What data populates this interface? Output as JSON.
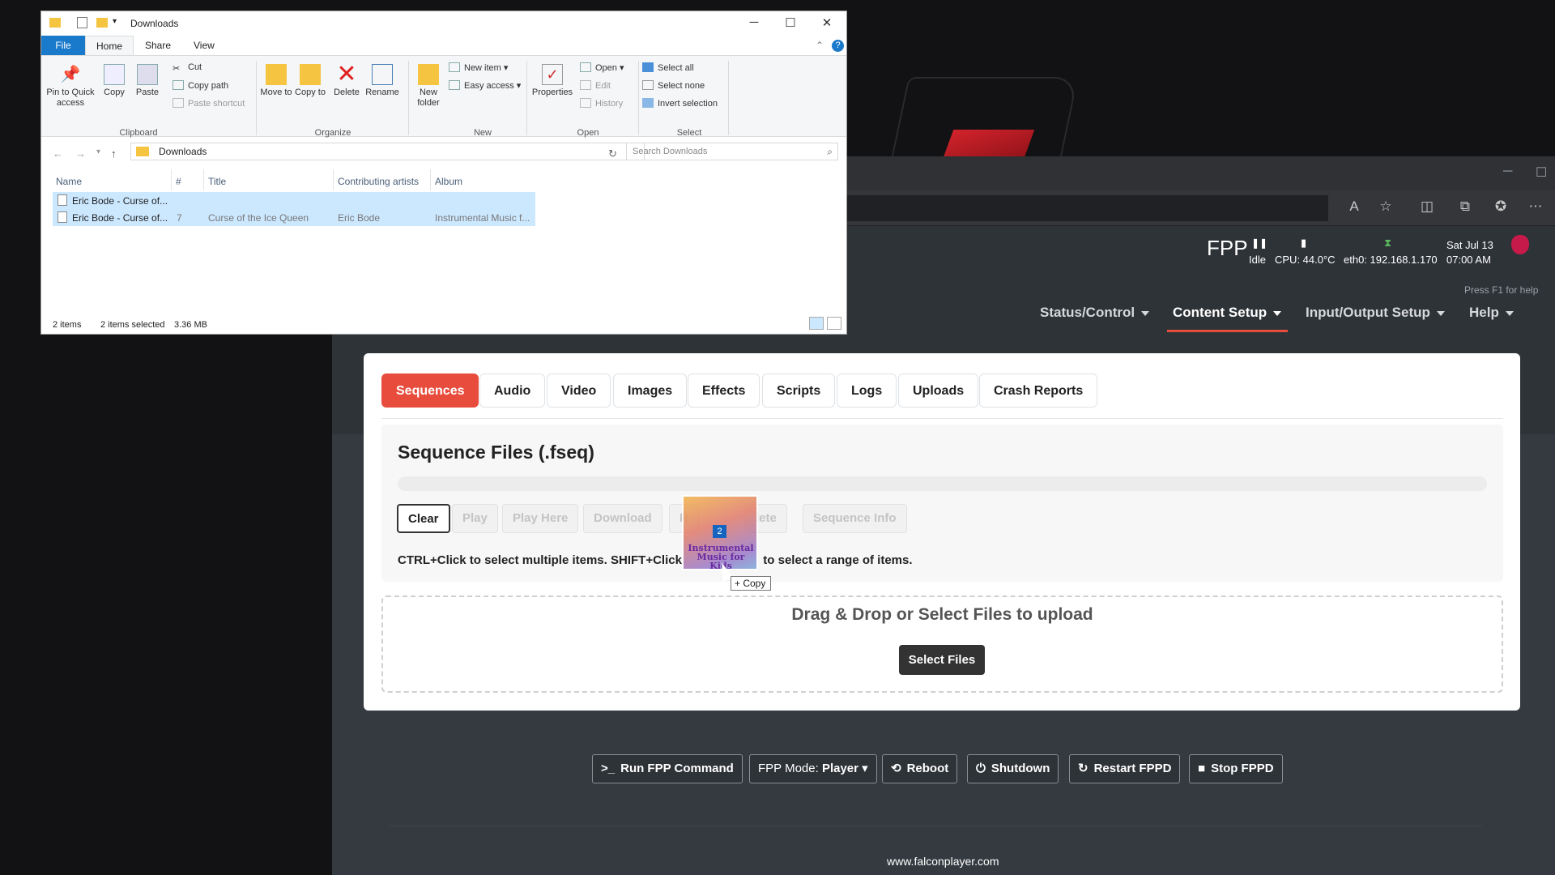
{
  "explorer": {
    "title": "Downloads",
    "window_controls": [
      "─",
      "☐",
      "✕"
    ],
    "tabs": {
      "file": "File",
      "home": "Home",
      "share": "Share",
      "view": "View"
    },
    "ribbon": {
      "pin": "Pin to Quick access",
      "copy": "Copy",
      "paste": "Paste",
      "cut": "Cut",
      "copy_path": "Copy path",
      "paste_shortcut": "Paste shortcut",
      "move_to": "Move to",
      "copy_to": "Copy to",
      "delete": "Delete",
      "rename": "Rename",
      "new_folder": "New folder",
      "new_item": "New item",
      "easy_access": "Easy access",
      "properties": "Properties",
      "open": "Open",
      "edit": "Edit",
      "history": "History",
      "select_all": "Select all",
      "select_none": "Select none",
      "invert_selection": "Invert selection",
      "groups": {
        "clipboard": "Clipboard",
        "organize": "Organize",
        "new": "New",
        "open": "Open",
        "select": "Select"
      }
    },
    "breadcrumb": "Downloads",
    "search_placeholder": "Search Downloads",
    "columns": {
      "name": "Name",
      "number": "#",
      "title": "Title",
      "artists": "Contributing artists",
      "album": "Album"
    },
    "rows": [
      {
        "name": "Eric Bode - Curse of...",
        "number": "",
        "title": "",
        "artists": "",
        "album": ""
      },
      {
        "name": "Eric Bode - Curse of...",
        "number": "7",
        "title": "Curse of the Ice Queen",
        "artists": "Eric Bode",
        "album": "Instrumental Music f..."
      }
    ],
    "status": {
      "count": "2 items",
      "selected": "2 items selected",
      "size": "3.36 MB"
    }
  },
  "fpp": {
    "logo": "FPP",
    "state": "Idle",
    "cpu": "CPU: 44.0°C",
    "network": "eth0: 192.168.1.170",
    "date": "Sat Jul 13",
    "time": "07:00 AM",
    "help_hint": "Press F1 for help",
    "nav": {
      "status": "Status/Control",
      "content": "Content Setup",
      "io": "Input/Output Setup",
      "help": "Help"
    },
    "tabs": {
      "sequences": "Sequences",
      "audio": "Audio",
      "video": "Video",
      "images": "Images",
      "effects": "Effects",
      "scripts": "Scripts",
      "logs": "Logs",
      "uploads": "Uploads",
      "crash": "Crash Reports"
    },
    "section_title": "Sequence Files (.fseq)",
    "buttons": {
      "clear": "Clear",
      "play": "Play",
      "play_here": "Play Here",
      "download": "Download",
      "rename": "R",
      "delete": "lete",
      "info": "Sequence Info"
    },
    "hint_left": "CTRL+Click to select multiple items. SHIFT+Click",
    "hint_right": "to select a range of items.",
    "drop_title": "Drag & Drop or Select Files to upload",
    "select_files": "Select Files",
    "footer_buttons": {
      "run": "Run FPP Command",
      "mode_label": "FPP Mode:",
      "mode_value": "Player",
      "reboot": "Reboot",
      "shutdown": "Shutdown",
      "restart": "Restart FPPD",
      "stop": "Stop FPPD"
    },
    "footer_link": "www.falconplayer.com"
  },
  "drag": {
    "count": "2",
    "album_text": "Instrumental Music for Kids",
    "tip": "+ Copy"
  },
  "colors": {
    "accent": "#e74c3c",
    "page": "#2e3338",
    "win_blue": "#1979ca"
  }
}
